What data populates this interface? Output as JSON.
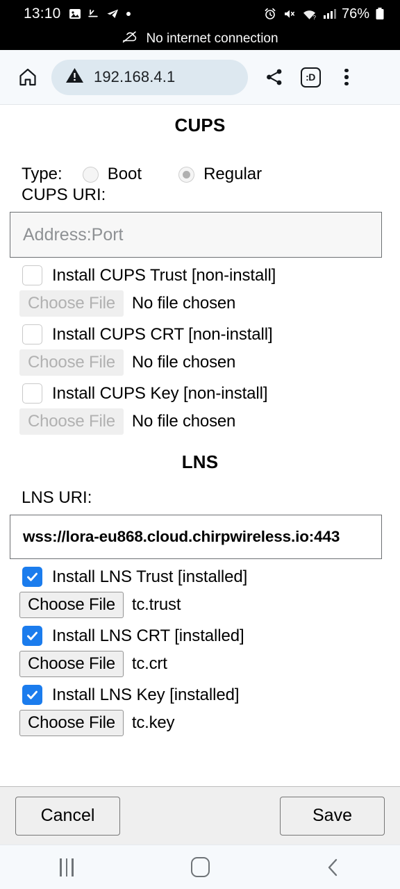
{
  "status_bar": {
    "time": "13:10",
    "battery_percent": "76%",
    "notification_text": "No internet connection",
    "left_icons": [
      "image-icon",
      "download-icon",
      "telegram-icon",
      "dot-icon"
    ],
    "right_icons": [
      "alarm-icon",
      "mute-icon",
      "wifi-no-internet-icon",
      "signal-icon",
      "battery-icon"
    ]
  },
  "browser": {
    "url": "192.168.4.1",
    "security_icon": "warning-triangle-icon",
    "tab_count_label": ":D",
    "icons": [
      "home-icon",
      "share-icon",
      "tab-counter-icon",
      "overflow-menu-icon"
    ]
  },
  "cups": {
    "heading": "CUPS",
    "type_label": "Type:",
    "type_options": [
      {
        "label": "Boot",
        "selected": false
      },
      {
        "label": "Regular",
        "selected": true
      }
    ],
    "uri_label": "CUPS URI:",
    "uri_value": "",
    "uri_placeholder": "Address:Port",
    "certs": [
      {
        "checkbox_label": "Install CUPS Trust [non-install]",
        "checked": false,
        "choose_label": "Choose File",
        "file_name": "No file chosen",
        "enabled": false
      },
      {
        "checkbox_label": "Install CUPS CRT [non-install]",
        "checked": false,
        "choose_label": "Choose File",
        "file_name": "No file chosen",
        "enabled": false
      },
      {
        "checkbox_label": "Install CUPS Key [non-install]",
        "checked": false,
        "choose_label": "Choose File",
        "file_name": "No file chosen",
        "enabled": false
      }
    ]
  },
  "lns": {
    "heading": "LNS",
    "uri_label": "LNS URI:",
    "uri_value": "wss://lora-eu868.cloud.chirpwireless.io:443",
    "certs": [
      {
        "checkbox_label": "Install LNS Trust [installed]",
        "checked": true,
        "choose_label": "Choose File",
        "file_name": "tc.trust",
        "enabled": true
      },
      {
        "checkbox_label": "Install LNS CRT [installed]",
        "checked": true,
        "choose_label": "Choose File",
        "file_name": "tc.crt",
        "enabled": true
      },
      {
        "checkbox_label": "Install LNS Key [installed]",
        "checked": true,
        "choose_label": "Choose File",
        "file_name": "tc.key",
        "enabled": true
      }
    ]
  },
  "footer": {
    "cancel_label": "Cancel",
    "save_label": "Save"
  },
  "nav_bar": {
    "icons": [
      "recents-icon",
      "home-icon",
      "back-icon"
    ]
  },
  "colors": {
    "checkbox_accent": "#1b7ced",
    "urlbar_background": "#dde8f0",
    "toolbar_background": "#f6f9fc",
    "statusbar_background": "#000000",
    "footer_background": "#efefef"
  }
}
